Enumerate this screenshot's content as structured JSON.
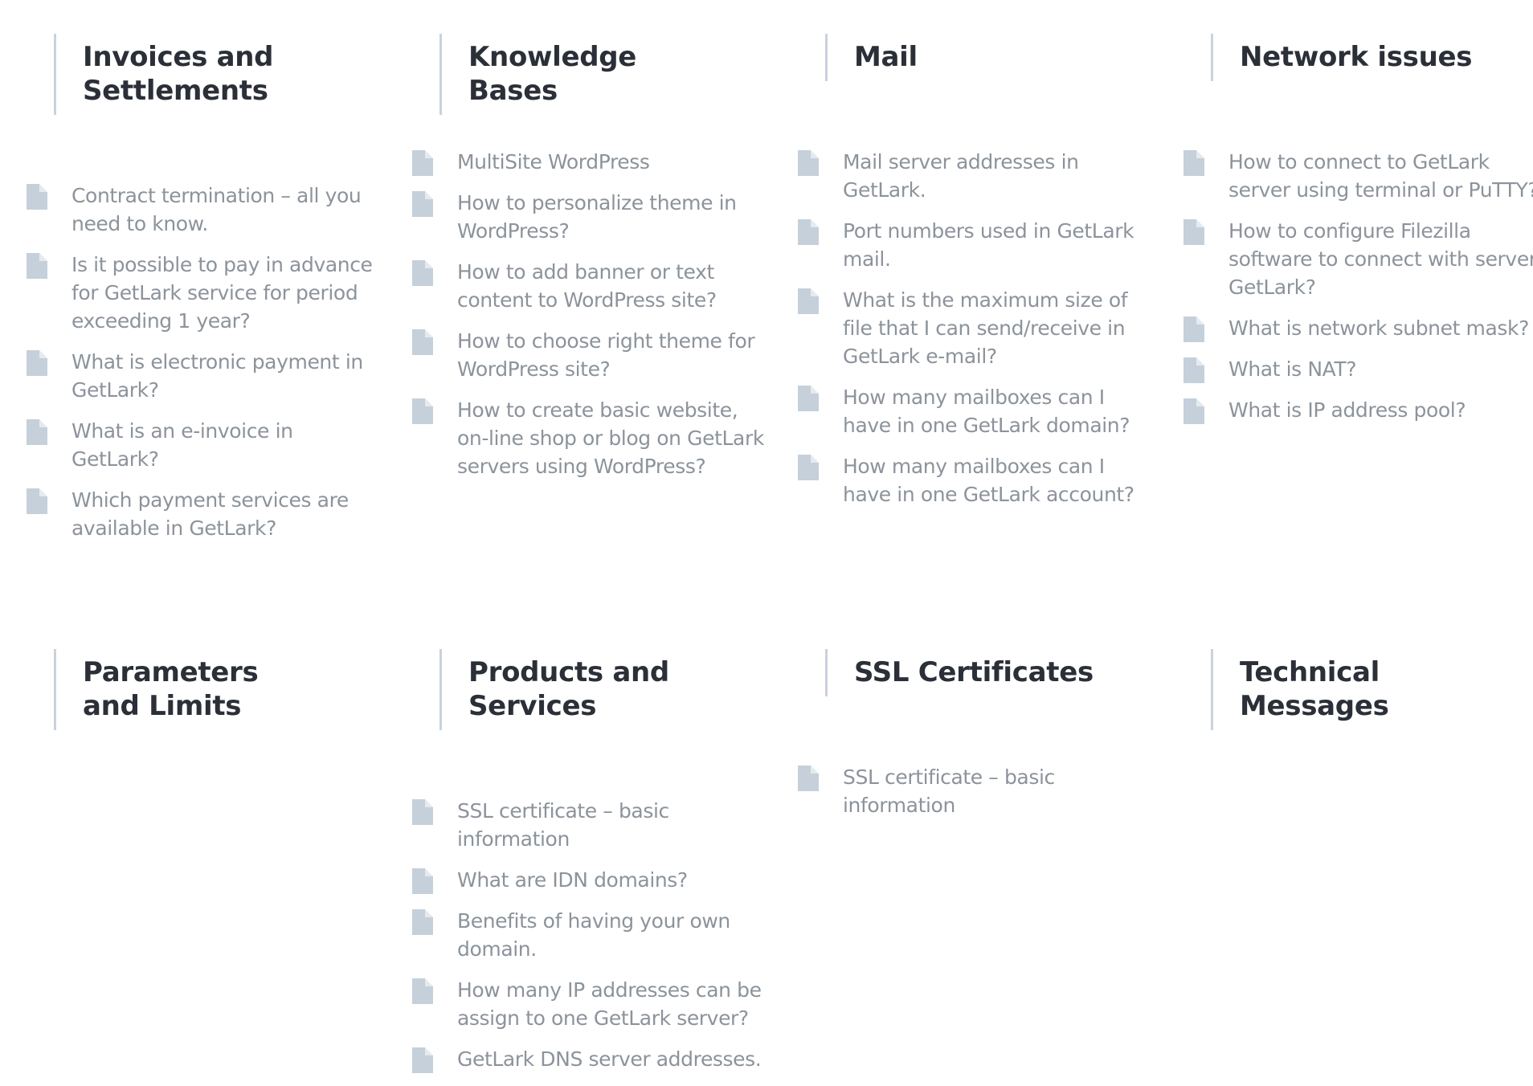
{
  "categories": [
    {
      "title": "Invoices and Settlements",
      "articles": [
        "Contract termination – all you need to know.",
        "Is it possible to pay in advance for GetLark service for period exceeding 1 year?",
        "What is electronic payment in GetLark?",
        "What is an e-invoice in GetLark?",
        "Which payment services are available in GetLark?"
      ]
    },
    {
      "title": "Knowledge Bases",
      "articles": [
        "MultiSite WordPress",
        "How to personalize theme in WordPress?",
        "How to add banner or text content to WordPress site?",
        "How to choose right theme for WordPress site?",
        "How to create basic website, on-line shop or blog on GetLark servers using WordPress?"
      ]
    },
    {
      "title": "Mail",
      "articles": [
        "Mail server addresses in GetLark.",
        "Port numbers used in GetLark mail.",
        "What is the maximum size of file that I can send/receive in GetLark e-mail?",
        "How many mailboxes can I have in one GetLark domain?",
        "How many mailboxes can I have in one GetLark account?"
      ]
    },
    {
      "title": "Network issues",
      "articles": [
        "How to connect to GetLark server using terminal or PuTTY?",
        "How to configure Filezilla software to connect with server GetLark?",
        "What is network subnet mask?",
        "What is NAT?",
        "What is IP address pool?"
      ]
    },
    {
      "title": "Parameters and Limits",
      "articles": []
    },
    {
      "title": "Products and Services",
      "articles": [
        "SSL certificate – basic information",
        "What are IDN domains?",
        "Benefits of having your own domain.",
        "How many IP addresses can be assign to one GetLark server?",
        "GetLark DNS server addresses."
      ]
    },
    {
      "title": "SSL Certificates",
      "articles": [
        "SSL certificate – basic information"
      ]
    },
    {
      "title": "Technical Messages",
      "articles": []
    }
  ],
  "icons": {
    "article": "document-icon"
  },
  "colors": {
    "heading": "#2b2f38",
    "article_text": "#8c939b",
    "icon": "#c5d0da",
    "divider": "#c9d2dc"
  }
}
